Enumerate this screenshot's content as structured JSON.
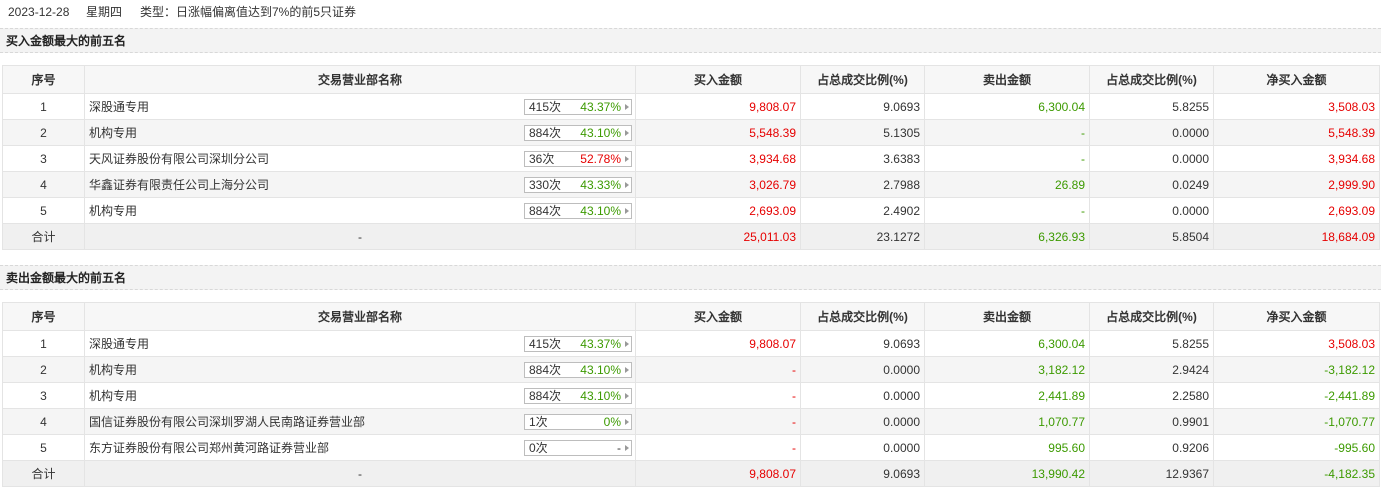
{
  "header": {
    "date": "2023-12-28",
    "weekday": "星期四",
    "type_label": "类型：日涨幅偏离值达到7%的前5只证券"
  },
  "columns": [
    "序号",
    "交易营业部名称",
    "买入金额",
    "占总成交比例(%)",
    "卖出金额",
    "占总成交比例(%)",
    "净买入金额"
  ],
  "colors": {
    "up": "#e60000",
    "down": "#3c9a00",
    "neutral": "#333333"
  },
  "buy_section": {
    "title": "买入金额最大的前五名",
    "rows": [
      {
        "no": "1",
        "name": "深股通专用",
        "times": "415次",
        "rate": "43.37%",
        "rate_color": "green",
        "buy": "9,808.07",
        "buy_pct": "9.0693",
        "sell": "6,300.04",
        "sell_pct": "5.8255",
        "net": "3,508.03",
        "net_color": "red"
      },
      {
        "no": "2",
        "name": "机构专用",
        "times": "884次",
        "rate": "43.10%",
        "rate_color": "green",
        "buy": "5,548.39",
        "buy_pct": "5.1305",
        "sell": "-",
        "sell_pct": "0.0000",
        "net": "5,548.39",
        "net_color": "red"
      },
      {
        "no": "3",
        "name": "天风证券股份有限公司深圳分公司",
        "times": "36次",
        "rate": "52.78%",
        "rate_color": "red",
        "buy": "3,934.68",
        "buy_pct": "3.6383",
        "sell": "-",
        "sell_pct": "0.0000",
        "net": "3,934.68",
        "net_color": "red"
      },
      {
        "no": "4",
        "name": "华鑫证券有限责任公司上海分公司",
        "times": "330次",
        "rate": "43.33%",
        "rate_color": "green",
        "buy": "3,026.79",
        "buy_pct": "2.7988",
        "sell": "26.89",
        "sell_pct": "0.0249",
        "net": "2,999.90",
        "net_color": "red"
      },
      {
        "no": "5",
        "name": "机构专用",
        "times": "884次",
        "rate": "43.10%",
        "rate_color": "green",
        "buy": "2,693.09",
        "buy_pct": "2.4902",
        "sell": "-",
        "sell_pct": "0.0000",
        "net": "2,693.09",
        "net_color": "red"
      }
    ],
    "total": {
      "label": "合计",
      "name": "-",
      "buy": "25,011.03",
      "buy_pct": "23.1272",
      "sell": "6,326.93",
      "sell_pct": "5.8504",
      "net": "18,684.09",
      "net_color": "red"
    }
  },
  "sell_section": {
    "title": "卖出金额最大的前五名",
    "rows": [
      {
        "no": "1",
        "name": "深股通专用",
        "times": "415次",
        "rate": "43.37%",
        "rate_color": "green",
        "buy": "9,808.07",
        "buy_pct": "9.0693",
        "sell": "6,300.04",
        "sell_pct": "5.8255",
        "net": "3,508.03",
        "net_color": "red"
      },
      {
        "no": "2",
        "name": "机构专用",
        "times": "884次",
        "rate": "43.10%",
        "rate_color": "green",
        "buy": "-",
        "buy_pct": "0.0000",
        "sell": "3,182.12",
        "sell_pct": "2.9424",
        "net": "-3,182.12",
        "net_color": "green"
      },
      {
        "no": "3",
        "name": "机构专用",
        "times": "884次",
        "rate": "43.10%",
        "rate_color": "green",
        "buy": "-",
        "buy_pct": "0.0000",
        "sell": "2,441.89",
        "sell_pct": "2.2580",
        "net": "-2,441.89",
        "net_color": "green"
      },
      {
        "no": "4",
        "name": "国信证券股份有限公司深圳罗湖人民南路证券营业部",
        "times": "1次",
        "rate": "0%",
        "rate_color": "green",
        "buy": "-",
        "buy_pct": "0.0000",
        "sell": "1,070.77",
        "sell_pct": "0.9901",
        "net": "-1,070.77",
        "net_color": "green"
      },
      {
        "no": "5",
        "name": "东方证券股份有限公司郑州黄河路证券营业部",
        "times": "0次",
        "rate": "-",
        "rate_color": "neutral",
        "buy": "-",
        "buy_pct": "0.0000",
        "sell": "995.60",
        "sell_pct": "0.9206",
        "net": "-995.60",
        "net_color": "green"
      }
    ],
    "total": {
      "label": "合计",
      "name": "-",
      "buy": "9,808.07",
      "buy_pct": "9.0693",
      "sell": "13,990.42",
      "sell_pct": "12.9367",
      "net": "-4,182.35",
      "net_color": "green"
    }
  }
}
